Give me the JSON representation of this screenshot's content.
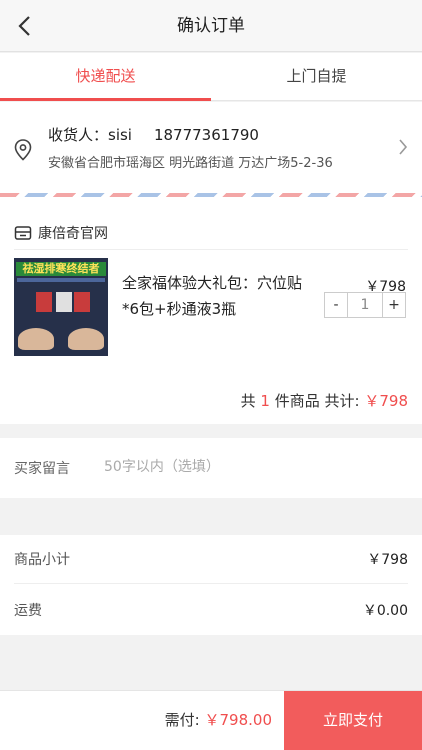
{
  "header": {
    "title": "确认订单",
    "back_icon": "chevron-left-icon"
  },
  "tabs": [
    {
      "label": "快递配送",
      "active": true
    },
    {
      "label": "上门自提",
      "active": false
    }
  ],
  "address": {
    "receiver_label": "收货人：sisi",
    "phone": "18777361790",
    "detail": "安徽省合肥市瑶海区 明光路街道 万达广场5-2-36"
  },
  "shop": {
    "name": "康倍奇官网",
    "item": {
      "image_caption": "祛湿排寒终结者",
      "name": "全家福体验大礼包：穴位贴*6包+秒通液3瓶",
      "price": "￥798",
      "quantity": "1",
      "minus": "-",
      "plus": "+"
    },
    "total_prefix": "共",
    "total_count": "1",
    "total_suffix": "件商品 共计:",
    "total_amount": "￥798"
  },
  "message": {
    "label": "买家留言",
    "placeholder": "50字以内（选填）"
  },
  "summary": {
    "subtotal_label": "商品小计",
    "subtotal_value": "￥798",
    "shipping_label": "运费",
    "shipping_value": "￥0.00"
  },
  "footer": {
    "need_label": "需付:",
    "need_amount": "￥798.00",
    "pay_button": "立即支付"
  },
  "colors": {
    "accent": "#f04e4e",
    "pay_button": "#f25c5c"
  }
}
